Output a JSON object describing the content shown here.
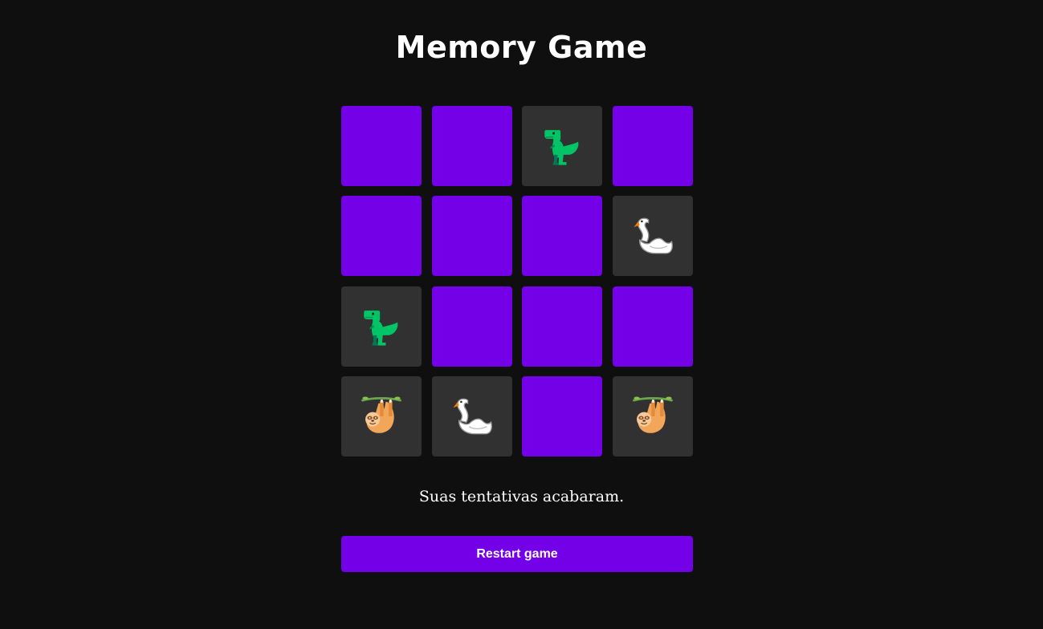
{
  "game": {
    "title": "Memory Game",
    "status_message": "Suas tentativas acabaram.",
    "restart_label": "Restart game"
  },
  "colors": {
    "background": "#0f0f0f",
    "card_back": "#7400e8",
    "card_face": "#313131",
    "button": "#7400e8",
    "text": "#ffffff"
  },
  "grid": {
    "rows": 4,
    "columns": 4
  },
  "cards": [
    {
      "state": "hidden",
      "icon": null
    },
    {
      "state": "hidden",
      "icon": null
    },
    {
      "state": "revealed",
      "icon": "t-rex-icon"
    },
    {
      "state": "hidden",
      "icon": null
    },
    {
      "state": "hidden",
      "icon": null
    },
    {
      "state": "hidden",
      "icon": null
    },
    {
      "state": "hidden",
      "icon": null
    },
    {
      "state": "revealed",
      "icon": "swan-icon"
    },
    {
      "state": "revealed",
      "icon": "t-rex-icon"
    },
    {
      "state": "hidden",
      "icon": null
    },
    {
      "state": "hidden",
      "icon": null
    },
    {
      "state": "hidden",
      "icon": null
    },
    {
      "state": "revealed",
      "icon": "sloth-icon"
    },
    {
      "state": "revealed",
      "icon": "swan-icon"
    },
    {
      "state": "hidden",
      "icon": null
    },
    {
      "state": "revealed",
      "icon": "sloth-icon"
    }
  ]
}
